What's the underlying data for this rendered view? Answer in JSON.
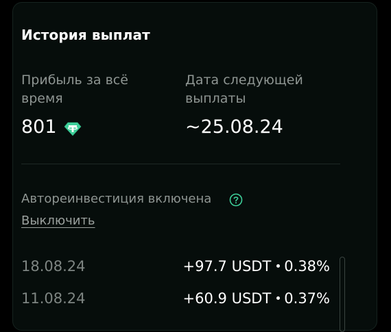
{
  "header": {
    "title": "История выплат"
  },
  "stats": {
    "total_profit_label": "Прибыль за всё время",
    "total_profit_value": "801",
    "currency_icon": "tether-icon",
    "next_payout_label": "Дата следующей выплаты",
    "next_payout_value": "~25.08.24"
  },
  "auto_invest": {
    "label": "Автореинвестиция включена",
    "help_icon": "question-circle-icon",
    "disable_link": "Выключить"
  },
  "payouts": [
    {
      "date": "18.08.24",
      "amount": "+97.7 USDT",
      "percent": "0.38%"
    },
    {
      "date": "11.08.24",
      "amount": "+60.9 USDT",
      "percent": "0.37%"
    }
  ],
  "colors": {
    "accent": "#3ecf9a",
    "background": "#060d0b"
  }
}
